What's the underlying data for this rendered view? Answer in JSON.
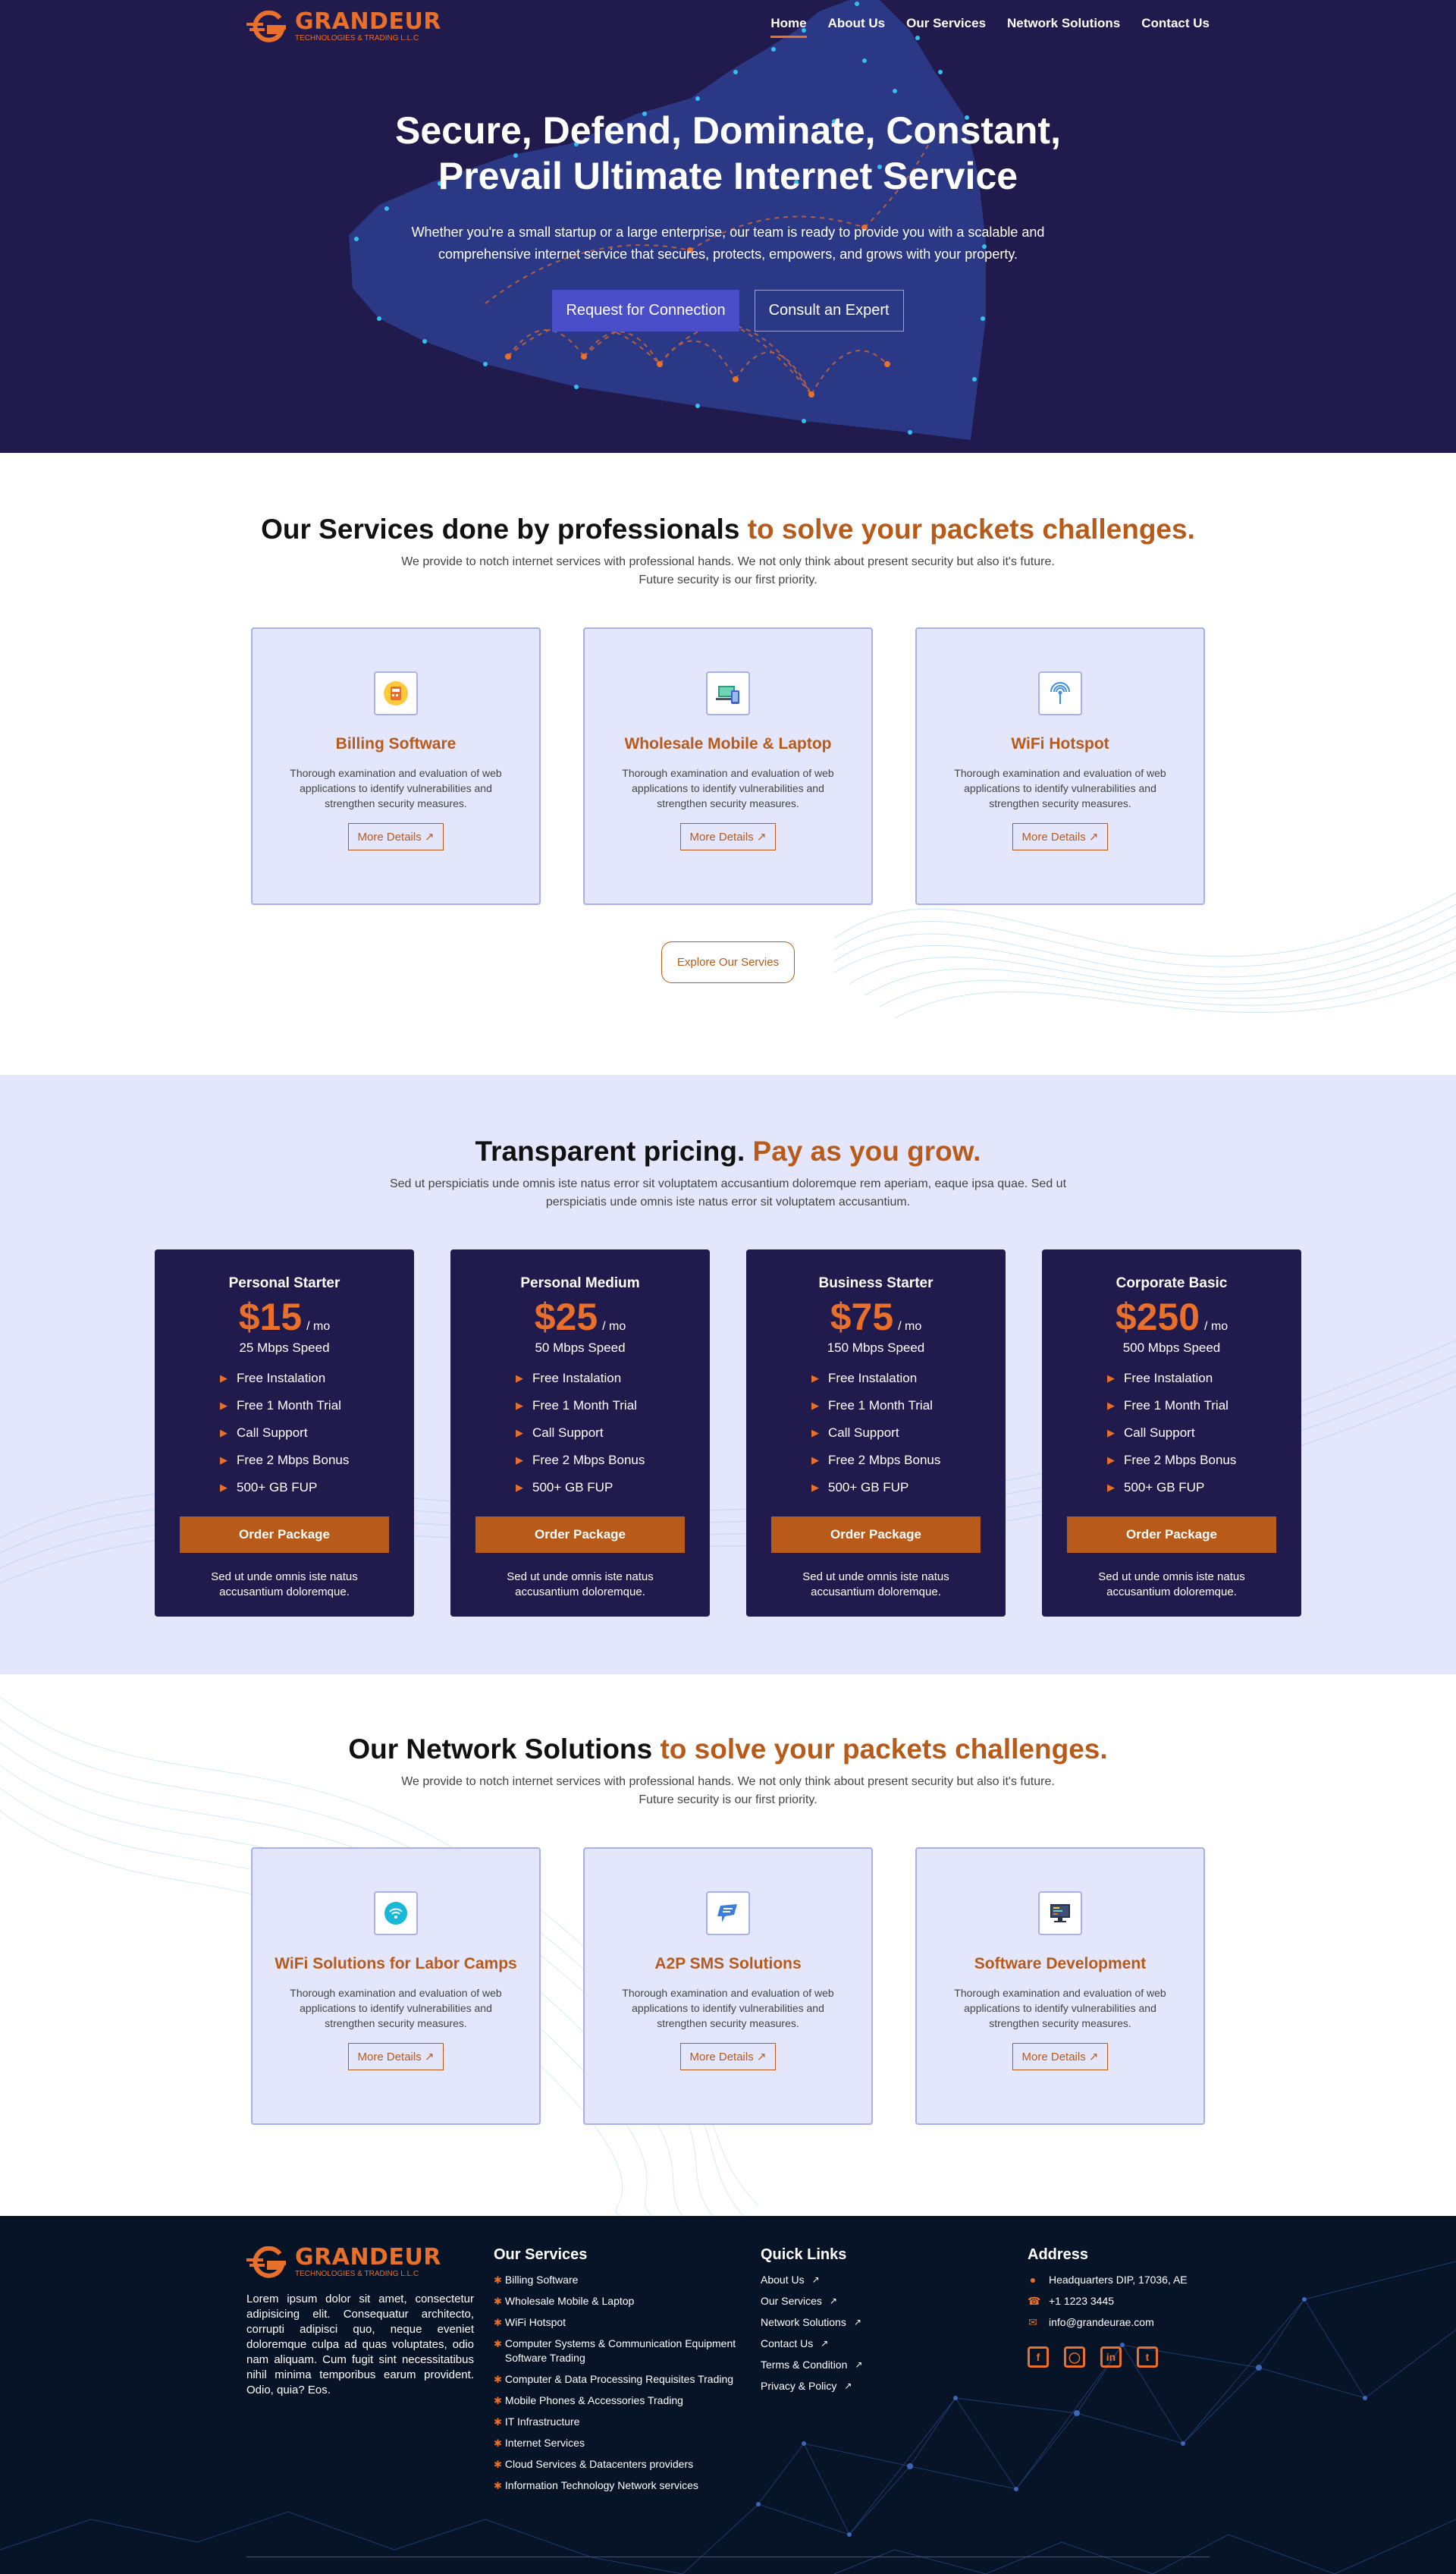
{
  "brand": {
    "name": "GRANDEUR",
    "tagline": "TECHNOLOGIES & TRADING L.L.C",
    "accent_color": "#e8702a",
    "primary_dark": "#201a4d"
  },
  "nav": {
    "items": [
      {
        "label": "Home",
        "active": true
      },
      {
        "label": "About Us",
        "active": false
      },
      {
        "label": "Our Services",
        "active": false
      },
      {
        "label": "Network Solutions",
        "active": false
      },
      {
        "label": "Contact Us",
        "active": false
      }
    ]
  },
  "hero": {
    "title": "Secure, Defend, Dominate, Constant, Prevail Ultimate Internet Service",
    "description": "Whether you're a small startup or a large enterprise, our team is ready to provide you with a scalable and comprehensive internet service that secures, protects, empowers, and grows with your property.",
    "primary_button": "Request for Connection",
    "secondary_button": "Consult an Expert"
  },
  "services": {
    "title": "Our Services done by professionals",
    "title_accent": "to solve your packets challenges.",
    "subtitle": "We provide to notch internet services with professional hands. We not only think about present security but also it's future. Future security is our first priority.",
    "cards": [
      {
        "title": "Billing Software",
        "icon": "billing-icon",
        "description": "Thorough examination and evaluation of web applications to identify vulnerabilities and strengthen security measures.",
        "button": "More Details ↗"
      },
      {
        "title": "Wholesale Mobile & Laptop",
        "icon": "devices-icon",
        "description": "Thorough examination and evaluation of web applications to identify vulnerabilities and strengthen security measures.",
        "button": "More Details ↗"
      },
      {
        "title": "WiFi Hotspot",
        "icon": "hotspot-icon",
        "description": "Thorough examination and evaluation of web applications to identify vulnerabilities and strengthen security measures.",
        "button": "More Details ↗"
      }
    ],
    "explore_button": "Explore Our Servies"
  },
  "pricing": {
    "title": "Transparent pricing.",
    "title_accent": "Pay as you grow.",
    "subtitle": "Sed ut perspiciatis unde omnis iste natus error sit voluptatem accusantium doloremque rem aperiam, eaque ipsa quae. Sed ut perspiciatis unde omnis iste natus error sit voluptatem accusantium.",
    "plans": [
      {
        "name": "Personal Starter",
        "price": "$15",
        "period": "/ mo",
        "speed": "25 Mbps Speed",
        "features": [
          "Free Instalation",
          "Free 1 Month Trial",
          "Call Support",
          "Free 2 Mbps Bonus",
          "500+ GB FUP"
        ],
        "button": "Order Package",
        "note": "Sed ut unde omnis iste natus accusantium doloremque."
      },
      {
        "name": "Personal Medium",
        "price": "$25",
        "period": "/ mo",
        "speed": "50 Mbps Speed",
        "features": [
          "Free Instalation",
          "Free 1 Month Trial",
          "Call Support",
          "Free 2 Mbps Bonus",
          "500+ GB FUP"
        ],
        "button": "Order Package",
        "note": "Sed ut unde omnis iste natus accusantium doloremque."
      },
      {
        "name": "Business Starter",
        "price": "$75",
        "period": "/ mo",
        "speed": "150 Mbps Speed",
        "features": [
          "Free Instalation",
          "Free 1 Month Trial",
          "Call Support",
          "Free 2 Mbps Bonus",
          "500+ GB FUP"
        ],
        "button": "Order Package",
        "note": "Sed ut unde omnis iste natus accusantium doloremque."
      },
      {
        "name": "Corporate Basic",
        "price": "$250",
        "period": "/ mo",
        "speed": "500 Mbps Speed",
        "features": [
          "Free Instalation",
          "Free 1 Month Trial",
          "Call Support",
          "Free 2 Mbps Bonus",
          "500+ GB FUP"
        ],
        "button": "Order Package",
        "note": "Sed ut unde omnis iste natus accusantium doloremque."
      }
    ]
  },
  "network": {
    "title": "Our Network Solutions",
    "title_accent": "to solve your packets challenges.",
    "subtitle": "We provide to notch internet services with professional hands. We not only think about present security but also it's future. Future security is our first priority.",
    "cards": [
      {
        "title": "WiFi Solutions for Labor Camps",
        "icon": "wifi-icon",
        "description": "Thorough examination and evaluation of web applications to identify vulnerabilities and strengthen security measures.",
        "button": "More Details ↗"
      },
      {
        "title": "A2P SMS Solutions",
        "icon": "sms-icon",
        "description": "Thorough examination and evaluation of web applications to identify vulnerabilities and strengthen security measures.",
        "button": "More Details ↗"
      },
      {
        "title": "Software Development",
        "icon": "software-icon",
        "description": "Thorough examination and evaluation of web applications to identify vulnerabilities and strengthen security measures.",
        "button": "More Details ↗"
      }
    ]
  },
  "footer": {
    "description": "Lorem ipsum dolor sit amet, consectetur adipisicing elit. Consequatur architecto, corrupti adipisci quo, neque eveniet doloremque culpa ad quas voluptates, odio nam aliquam. Cum fugit sint necessitatibus nihil minima temporibus earum provident. Odio, quia? Eos.",
    "services_heading": "Our Services",
    "services": [
      "Billing Software",
      "Wholesale Mobile & Laptop",
      "WiFi Hotspot",
      "Computer Systems & Communication Equipment Software Trading",
      "Computer & Data Processing Requisites Trading",
      "Mobile Phones & Accessories Trading",
      "IT Infrastructure",
      "Internet Services",
      "Cloud Services & Datacenters providers",
      "Information Technology Network services"
    ],
    "links_heading": "Quick Links",
    "links": [
      "About Us",
      "Our Services",
      "Network Solutions",
      "Contact Us",
      "Terms & Condition",
      "Privacy & Policy"
    ],
    "address_heading": "Address",
    "address": "Headquarters DIP, 17036, AE",
    "phone": "+1 1223 3445",
    "email": "info@grandeurae.com",
    "socials": [
      "facebook-icon",
      "instagram-icon",
      "linkedin-icon",
      "twitter-icon"
    ]
  }
}
